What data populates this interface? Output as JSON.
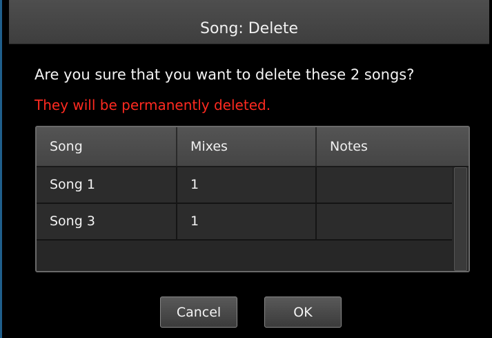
{
  "dialog": {
    "title": "Song: Delete",
    "question": "Are you sure that you want to delete these 2 songs?",
    "warning": "They will be permanently deleted.",
    "warning_color": "#ff2a20"
  },
  "table": {
    "columns": [
      "Song",
      "Mixes",
      "Notes"
    ],
    "rows": [
      {
        "song": "Song 1",
        "mixes": "1",
        "notes": ""
      },
      {
        "song": "Song 3",
        "mixes": "1",
        "notes": ""
      }
    ]
  },
  "buttons": {
    "cancel_label": "Cancel",
    "ok_label": "OK"
  }
}
